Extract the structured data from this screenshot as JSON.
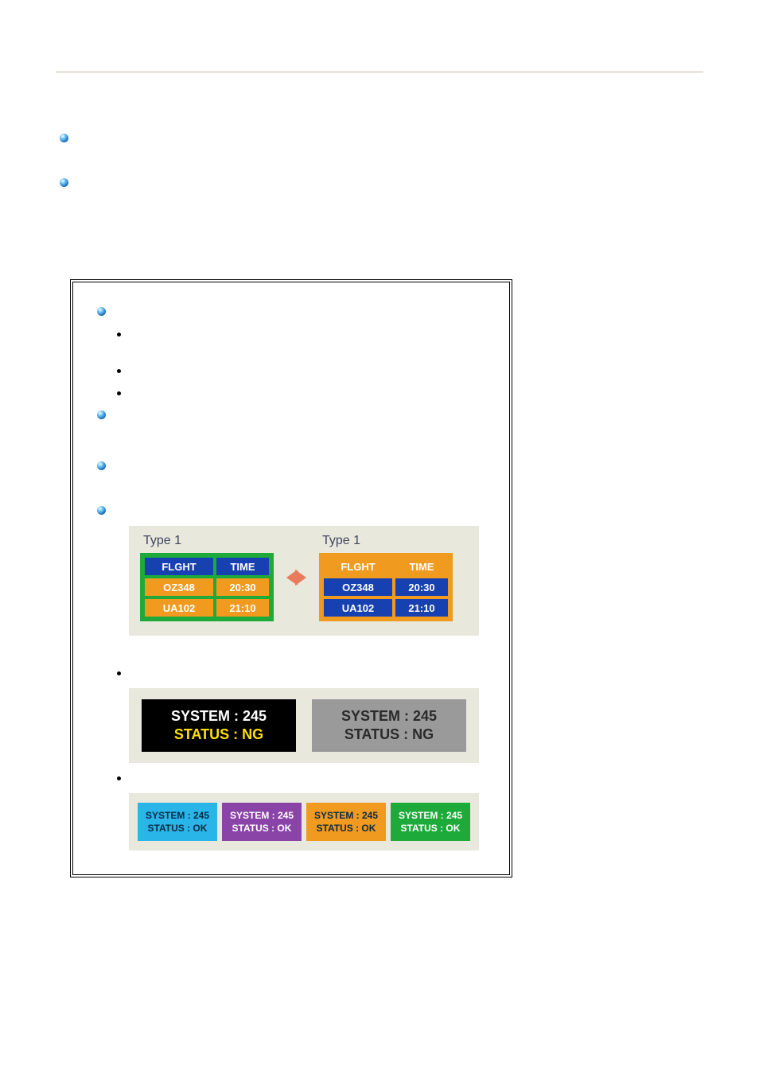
{
  "figure_type1": {
    "label": "Type 1",
    "table_headers": {
      "col1": "FLGHT",
      "col2": "TIME"
    },
    "rows": [
      {
        "flight": "OZ348",
        "time": "20:30"
      },
      {
        "flight": "UA102",
        "time": "21:10"
      }
    ]
  },
  "status_ng": {
    "line1": "SYSTEM : 245",
    "line2": "STATUS : NG"
  },
  "status_ok": {
    "line1": "SYSTEM : 245",
    "line2": "STATUS : OK"
  }
}
